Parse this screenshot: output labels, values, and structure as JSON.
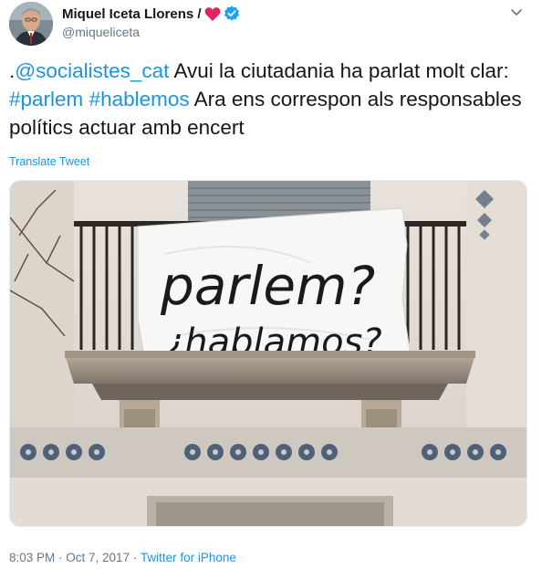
{
  "author": {
    "display_name": "Miquel Iceta Llorens /",
    "handle": "@miqueliceta",
    "verified": true,
    "heart_color": "#e0245e",
    "verified_color": "#1da1f2"
  },
  "tweet": {
    "prefix": ".",
    "mention": "@socialistes_cat",
    "text_1": " Avui la ciutadania ha parlat molt clar: ",
    "hashtag_1": "#parlem",
    "space": " ",
    "hashtag_2": "#hablemos",
    "text_2": " Ara ens correspon als responsables polítics actuar amb encert",
    "translate_label": "Translate Tweet"
  },
  "media": {
    "banner_line_1": "parlem?",
    "banner_line_2": "¿hablamos?"
  },
  "meta": {
    "time": "8:03 PM",
    "separator": " · ",
    "date": "Oct 7, 2017",
    "source": "Twitter for iPhone"
  },
  "colors": {
    "link": "#1b95e0",
    "secondary_text": "#657786"
  }
}
